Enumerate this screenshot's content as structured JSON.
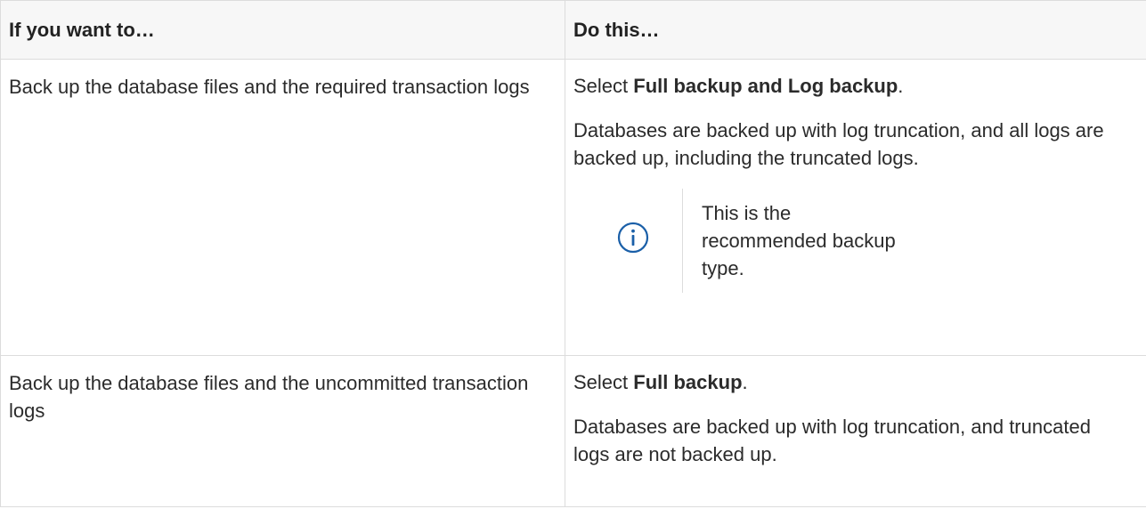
{
  "table": {
    "headers": [
      "If you want to…",
      "Do this…"
    ],
    "rows": [
      {
        "want": "Back up the database files and the required transaction logs",
        "select_prefix": "Select ",
        "select_bold": "Full backup and Log backup",
        "select_suffix": ".",
        "description": "Databases are backed up with log truncation, and all logs are backed up, including the truncated logs.",
        "note": "This is the recommended backup type."
      },
      {
        "want": "Back up the database files and the uncommitted transaction logs",
        "select_prefix": "Select ",
        "select_bold": "Full backup",
        "select_suffix": ".",
        "description": "Databases are backed up with log truncation, and truncated logs are not backed up."
      }
    ]
  },
  "colors": {
    "info_icon": "#1a5fa8",
    "border": "#dcdcdc",
    "header_bg": "#f7f7f7"
  },
  "icons": {
    "note_icon": "info-icon"
  }
}
